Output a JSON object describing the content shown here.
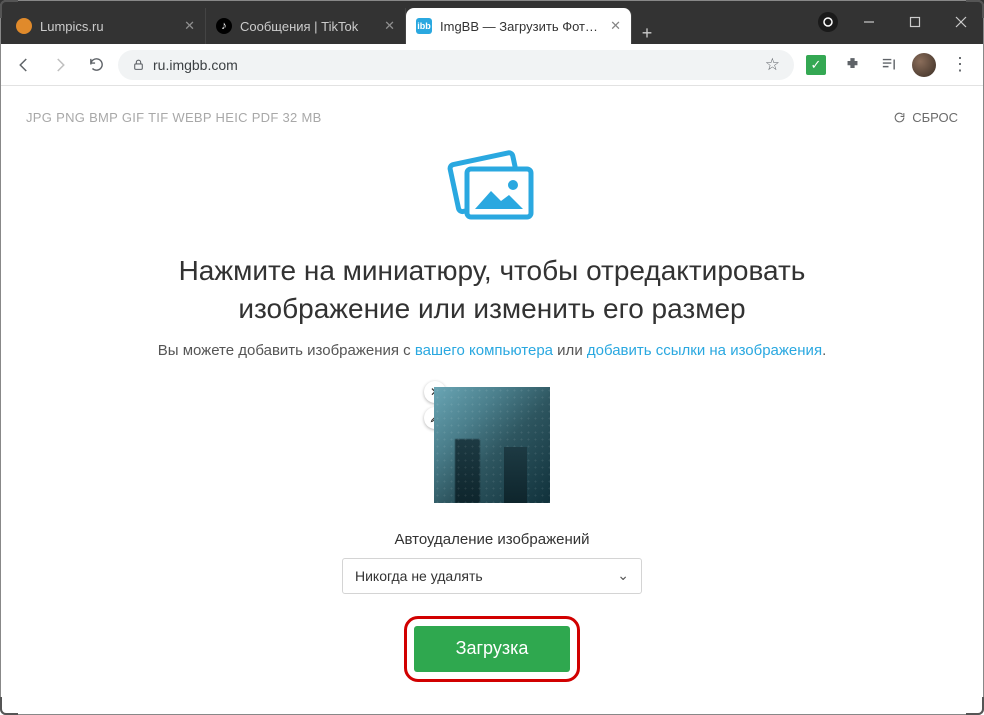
{
  "window": {
    "tabs": [
      {
        "label": "Lumpics.ru"
      },
      {
        "label": "Сообщения | TikTok"
      },
      {
        "label": "ImgBB — Загрузить Фото — X"
      }
    ]
  },
  "toolbar": {
    "url_host": "ru.imgbb.com"
  },
  "page": {
    "formats": "JPG PNG BMP GIF TIF WEBP HEIC PDF  32 MB",
    "reset": "СБРОС",
    "heading_line1": "Нажмите на миниатюру, чтобы отредактировать",
    "heading_line2": "изображение или изменить его размер",
    "lead_pre": "Вы можете добавить изображения с ",
    "lead_link1": "вашего компьютера",
    "lead_mid": " или ",
    "lead_link2": "добавить ссылки на изображения",
    "lead_post": ".",
    "autodelete_label": "Автоудаление изображений",
    "autodelete_value": "Никогда не удалять",
    "upload_button": "Загрузка"
  }
}
